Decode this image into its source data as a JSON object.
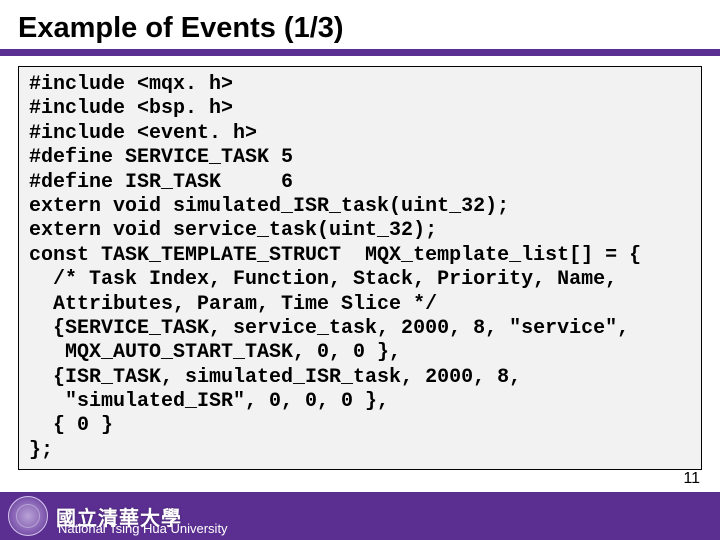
{
  "title": "Example of Events (1/3)",
  "code": "#include <mqx. h>\n#include <bsp. h>\n#include <event. h>\n#define SERVICE_TASK 5\n#define ISR_TASK     6\nextern void simulated_ISR_task(uint_32);\nextern void service_task(uint_32);\nconst TASK_TEMPLATE_STRUCT  MQX_template_list[] = {\n  /* Task Index, Function, Stack, Priority, Name,\n  Attributes, Param, Time Slice */\n  {SERVICE_TASK, service_task, 2000, 8, \"service\",\n   MQX_AUTO_START_TASK, 0, 0 },\n  {ISR_TASK, simulated_ISR_task, 2000, 8,\n   \"simulated_ISR\", 0, 0, 0 },\n  { 0 }\n};",
  "footer": {
    "cjk": "國立清華大學",
    "university": "National Tsing Hua University"
  },
  "page_number": "11"
}
